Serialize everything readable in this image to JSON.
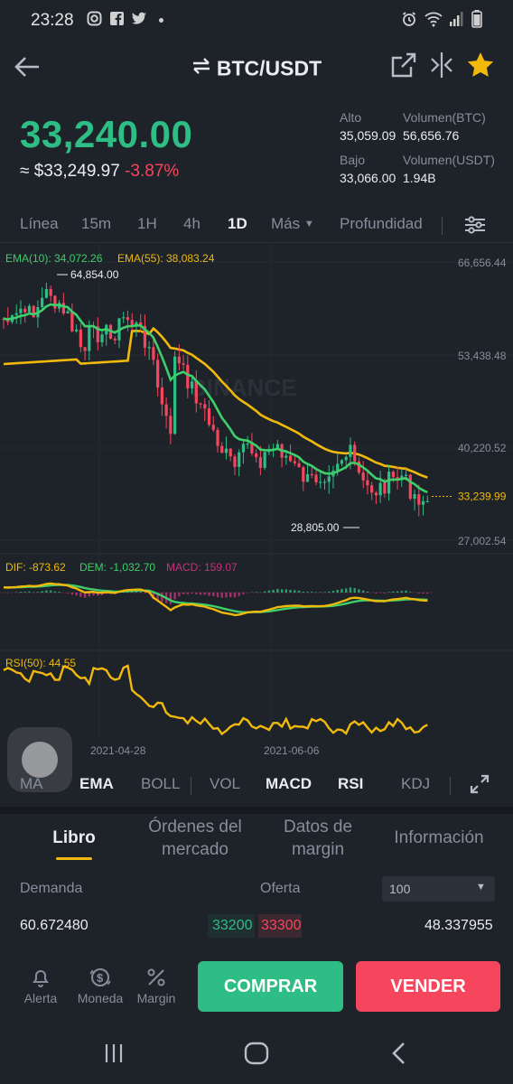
{
  "status": {
    "time": "23:28"
  },
  "header": {
    "pair": "BTC/USDT"
  },
  "price": {
    "last": "33,240.00",
    "approx": "≈ $33,249.97",
    "change": "-3.87%"
  },
  "stats": {
    "high_label": "Alto",
    "high": "35,059.09",
    "low_label": "Bajo",
    "low": "33,066.00",
    "vol_btc_label": "Volumen(BTC)",
    "vol_btc": "56,656.76",
    "vol_usdt_label": "Volumen(USDT)",
    "vol_usdt": "1.94B"
  },
  "timeframes": [
    "Línea",
    "15m",
    "1H",
    "4h",
    "1D",
    "Más",
    "Profundidad"
  ],
  "active_timeframe": "1D",
  "chart_data": {
    "type": "candlestick",
    "watermark": "BINANCE",
    "legend": {
      "ema10": "EMA(10): 34,072.26",
      "ema55": "EMA(55): 38,083.24"
    },
    "y_ticks": [
      "66,656.44",
      "53,438.48",
      "40,220.52",
      "27,002.54"
    ],
    "ylim": [
      27002.54,
      66656.44
    ],
    "current_price": "33,239.99",
    "current_price_value": 33239.99,
    "high_marker": "64,854.00",
    "high_value": 64854.0,
    "low_marker": "28,805.00",
    "low_value": 28805.0,
    "x_ticks": [
      "2021-04-28",
      "2021-06-06"
    ],
    "macd_legend": {
      "dif": "DIF: -873.62",
      "dem": "DEM: -1,032.70",
      "macd": "MACD: 159.07"
    },
    "rsi_legend": "RSI(50): 44.55",
    "colors": {
      "up": "#2ebd85",
      "down": "#f6465d",
      "ema10": "#3ecf6a",
      "ema55": "#f0b90b",
      "macd": "#c2347a"
    }
  },
  "indicators": [
    "MA",
    "EMA",
    "BOLL",
    "VOL",
    "MACD",
    "RSI",
    "KDJ"
  ],
  "indicators_on": [
    "EMA",
    "MACD",
    "RSI"
  ],
  "book_tabs": [
    {
      "line1": "Libro",
      "line2": ""
    },
    {
      "line1": "Órdenes del",
      "line2": "mercado"
    },
    {
      "line1": "Datos de",
      "line2": "margin"
    },
    {
      "line1": "Información",
      "line2": ""
    }
  ],
  "orderbook": {
    "bid_label": "Demanda",
    "ask_label": "Oferta",
    "depth": "100",
    "bid_qty": "60.672480",
    "bid_price": "33200",
    "ask_price": "33300",
    "ask_qty": "48.337955"
  },
  "bottom": {
    "alert": "Alerta",
    "coin": "Moneda",
    "margin": "Margin",
    "buy": "COMPRAR",
    "sell": "VENDER"
  },
  "theme": {
    "bg": "#1e2329",
    "green": "#2ebd85",
    "red": "#f6465d",
    "yellow": "#f0b90b"
  }
}
